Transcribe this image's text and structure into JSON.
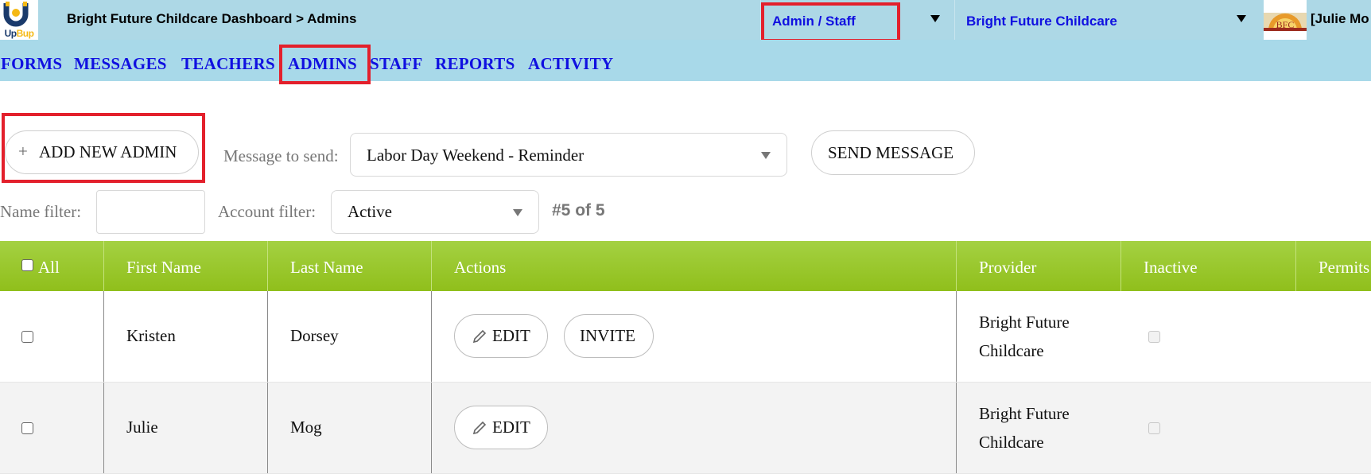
{
  "header": {
    "logo_text_1": "Up",
    "logo_text_2": "Bup",
    "breadcrumb": "Bright Future Childcare Dashboard > Admins",
    "role_select": "Admin / Staff",
    "org_select": "Bright Future Childcare",
    "avatar_text": "BFC",
    "user_name": "[Julie Mo"
  },
  "nav": {
    "items": [
      "FORMS",
      "MESSAGES",
      "TEACHERS",
      "ADMINS",
      "STAFF",
      "REPORTS",
      "ACTIVITY"
    ]
  },
  "toolbar": {
    "add_label": "ADD NEW ADMIN",
    "plus": "+",
    "message_label": "Message to send:",
    "message_value": "Labor Day Weekend - Reminder",
    "send_label": "SEND MESSAGE",
    "name_filter_label": "Name filter:",
    "name_filter_value": "",
    "account_filter_label": "Account filter:",
    "account_filter_value": "Active",
    "count": "#5 of 5"
  },
  "table": {
    "headers": [
      "All",
      "First Name",
      "Last Name",
      "Actions",
      "Provider",
      "Inactive",
      "Permits"
    ],
    "rows": [
      {
        "first": "Kristen",
        "last": "Dorsey",
        "actions": [
          "EDIT",
          "INVITE"
        ],
        "provider_1": "Bright Future",
        "provider_2": "Childcare"
      },
      {
        "first": "Julie",
        "last": "Mog",
        "actions": [
          "EDIT"
        ],
        "provider_1": "Bright Future",
        "provider_2": "Childcare"
      }
    ]
  },
  "colors": {
    "header_bg": "#add8e6",
    "nav_link": "#1010e0",
    "table_header": "#98c624",
    "highlight": "#e3202c"
  }
}
